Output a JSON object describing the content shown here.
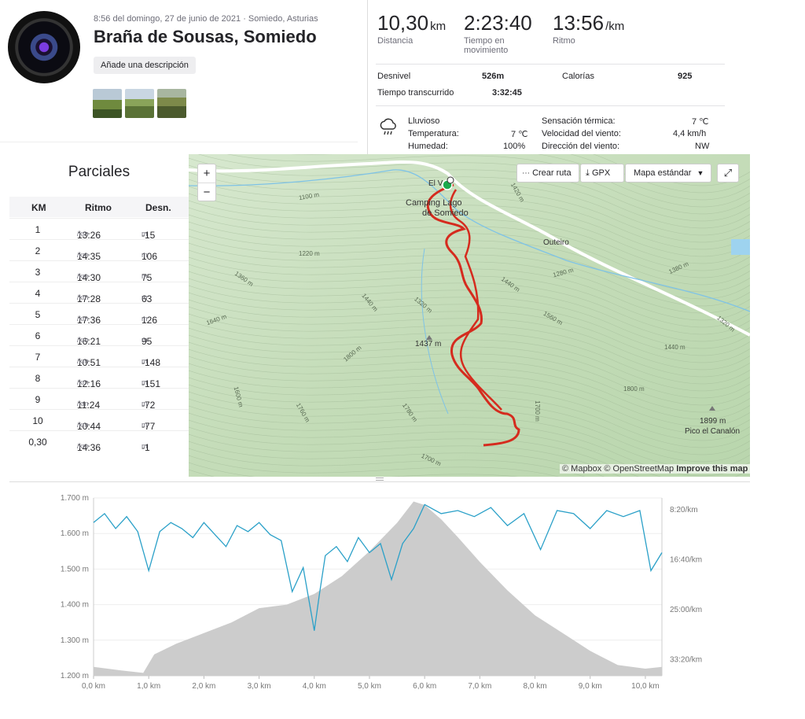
{
  "activity": {
    "meta": "8:56 del domingo, 27 de junio de 2021 · Somiedo, Asturias",
    "title": "Braña de Sousas, Somiedo",
    "description_button": "Añade una descripción"
  },
  "stats": {
    "distance": {
      "value": "10,30",
      "unit": "km",
      "label": "Distancia"
    },
    "moving_time": {
      "value": "2:23:40",
      "label_line1": "Tiempo en",
      "label_line2": "movimiento"
    },
    "pace": {
      "value": "13:56",
      "unit": "/km",
      "label": "Ritmo"
    },
    "elevation_label": "Desnivel",
    "elevation_value": "526m",
    "calories_label": "Calorías",
    "calories_value": "925",
    "elapsed_label": "Tiempo transcurrido",
    "elapsed_value": "3:32:45"
  },
  "weather": {
    "condition": "Lluvioso",
    "temp_label": "Temperatura:",
    "temp_value": "7 ℃",
    "humidity_label": "Humedad:",
    "humidity_value": "100%",
    "feels_label": "Sensación térmica:",
    "feels_value": "7 ℃",
    "wind_speed_label": "Velocidad del viento:",
    "wind_speed_value": "4,4 km/h",
    "wind_dir_label": "Dirección del viento:",
    "wind_dir_value": "NW"
  },
  "splits": {
    "title": "Parciales",
    "headers": [
      "KM",
      "Ritmo",
      "Desn."
    ],
    "pace_unit": "/km",
    "elev_unit": "m",
    "rows": [
      {
        "km": "1",
        "pace": "13:26",
        "elev": "-15"
      },
      {
        "km": "2",
        "pace": "14:35",
        "elev": "106"
      },
      {
        "km": "3",
        "pace": "14:30",
        "elev": "75"
      },
      {
        "km": "4",
        "pace": "17:28",
        "elev": "63"
      },
      {
        "km": "5",
        "pace": "17:36",
        "elev": "126"
      },
      {
        "km": "6",
        "pace": "16:21",
        "elev": "95"
      },
      {
        "km": "7",
        "pace": "10:51",
        "elev": "-148"
      },
      {
        "km": "8",
        "pace": "12:16",
        "elev": "-151"
      },
      {
        "km": "9",
        "pace": "11:24",
        "elev": "-72"
      },
      {
        "km": "10",
        "pace": "10:44",
        "elev": "-77"
      },
      {
        "km": "0,30",
        "pace": "14:36",
        "elev": "-1"
      }
    ]
  },
  "map": {
    "zoom_in": "+",
    "zoom_out": "−",
    "create_route": "Crear ruta",
    "gpx": "GPX",
    "map_style": "Mapa estándar",
    "attribution_mapbox": "© Mapbox",
    "attribution_osm": "© OpenStreetMap",
    "improve": "Improve this map",
    "labels": {
      "camping1": "Camping Lago",
      "camping2": "de Somiedo",
      "village": "El V",
      "outeiro": "Outeiro",
      "peak1": "1437 m",
      "peak2": "1899 m",
      "peak2_name": "Pico el Canalón",
      "c1100": "1100 m",
      "c1220": "1220 m",
      "c1360": "1360 m",
      "c1440a": "1440 m",
      "c1640": "1640 m",
      "c1320": "1320 m",
      "c1440b": "1440 m",
      "c1280": "1280 m",
      "c1560": "1560 m",
      "c1380": "1380 m",
      "c1420": "1420 m",
      "c1320b": "1320 m",
      "c1440c": "1440 m",
      "c1800": "1800 m",
      "c1600": "1600 m",
      "c1760": "1760 m",
      "c1780": "1780 m",
      "c1700": "1700 m",
      "c1700b": "1700 m",
      "c1800b": "1800 m"
    }
  },
  "chart_data": {
    "type": "area",
    "xlabel": "",
    "x_ticks": [
      "0,0 km",
      "1,0 km",
      "2,0 km",
      "3,0 km",
      "4,0 km",
      "5,0 km",
      "6,0 km",
      "7,0 km",
      "8,0 km",
      "9,0 km",
      "10,0 km"
    ],
    "y_left_ticks": [
      "1.700 m",
      "1.600 m",
      "1.500 m",
      "1.400 m",
      "1.300 m",
      "1.200 m"
    ],
    "y_right_ticks": [
      "8:20/km",
      "16:40/km",
      "25:00/km",
      "33:20/km"
    ],
    "xlim": [
      0,
      10.3
    ],
    "ylim_left": [
      1200,
      1700
    ],
    "series": [
      {
        "axis": "left",
        "color": "#cccccc",
        "x": [
          0,
          0.5,
          0.9,
          1.1,
          1.5,
          2.0,
          2.5,
          3.0,
          3.5,
          4.0,
          4.5,
          5.0,
          5.5,
          5.8,
          6.0,
          6.3,
          6.6,
          7.0,
          7.5,
          8.0,
          8.5,
          9.0,
          9.5,
          10.0,
          10.3
        ],
        "values": [
          1225,
          1215,
          1208,
          1260,
          1290,
          1320,
          1350,
          1390,
          1400,
          1430,
          1480,
          1550,
          1630,
          1690,
          1680,
          1640,
          1590,
          1520,
          1440,
          1370,
          1320,
          1270,
          1230,
          1220,
          1225
        ]
      },
      {
        "axis": "right",
        "color": "#2aa0c8",
        "x": [
          0,
          0.2,
          0.4,
          0.6,
          0.8,
          1.0,
          1.2,
          1.4,
          1.6,
          1.8,
          2.0,
          2.2,
          2.4,
          2.6,
          2.8,
          3.0,
          3.2,
          3.4,
          3.6,
          3.8,
          4.0,
          4.1,
          4.2,
          4.4,
          4.6,
          4.8,
          5.0,
          5.2,
          5.4,
          5.6,
          5.8,
          6.0,
          6.3,
          6.6,
          6.9,
          7.2,
          7.5,
          7.8,
          8.1,
          8.4,
          8.7,
          9.0,
          9.3,
          9.6,
          9.9,
          10.1,
          10.3
        ],
        "values": [
          10.5,
          9.0,
          11.5,
          9.5,
          12.0,
          18.5,
          12.0,
          10.5,
          11.5,
          13.0,
          10.5,
          12.5,
          14.5,
          11.0,
          12.0,
          10.5,
          12.5,
          13.5,
          22.0,
          18.0,
          28.5,
          22.0,
          16.0,
          14.5,
          17.0,
          13.0,
          15.5,
          14.0,
          20.0,
          14.0,
          11.5,
          7.5,
          9.0,
          8.5,
          9.5,
          8.0,
          11.0,
          9.0,
          15.0,
          8.5,
          9.0,
          11.5,
          8.5,
          9.5,
          8.5,
          18.5,
          15.5
        ]
      }
    ]
  }
}
